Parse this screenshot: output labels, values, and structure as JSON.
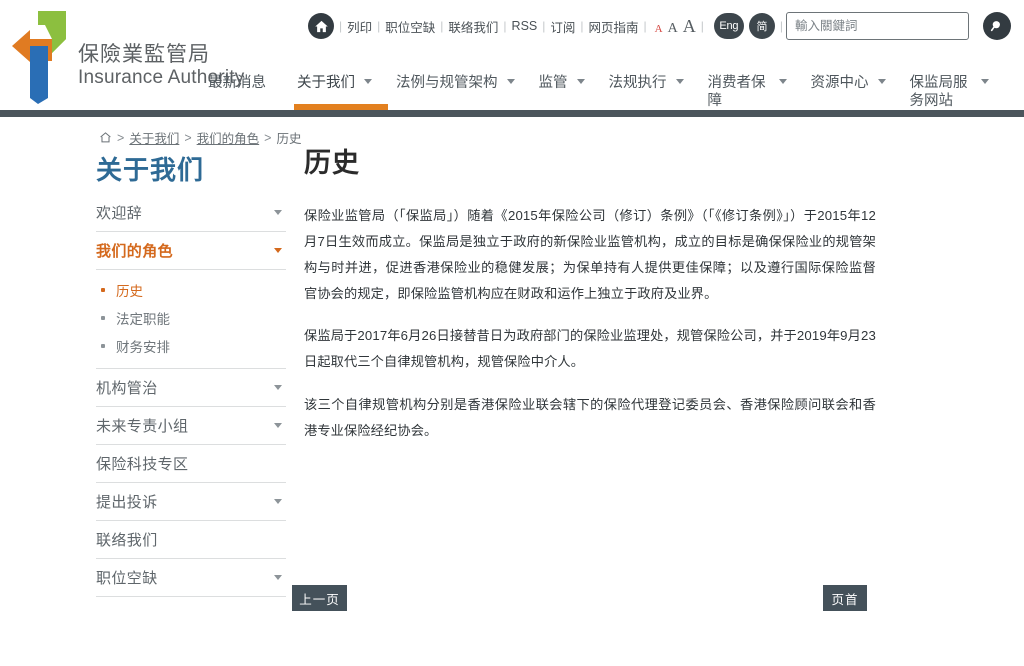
{
  "brand": {
    "logo_icon": "insurance-authority-logo",
    "name_cn": "保險業監管局",
    "name_en": "Insurance Authority",
    "colors": {
      "orange": "#e07b22",
      "green": "#8cbf3f",
      "blue": "#2a6eb5",
      "slate": "#4b555c"
    }
  },
  "utility": {
    "home_icon": "home-icon",
    "links": [
      {
        "label": "列印",
        "name": "print"
      },
      {
        "label": "职位空缺",
        "name": "job-vacancies"
      },
      {
        "label": "联络我们",
        "name": "contact-us"
      },
      {
        "label": "RSS",
        "name": "rss"
      },
      {
        "label": "订阅",
        "name": "subscribe"
      },
      {
        "label": "网页指南",
        "name": "sitemap"
      }
    ],
    "font_sizes": [
      {
        "label": "A",
        "size": "small",
        "active": true
      },
      {
        "label": "A",
        "size": "medium",
        "active": false
      },
      {
        "label": "A",
        "size": "large",
        "active": false
      }
    ],
    "languages": [
      {
        "label": "Eng",
        "name": "english"
      },
      {
        "label": "简",
        "name": "simplified-chinese"
      }
    ],
    "separator": "|"
  },
  "search": {
    "placeholder": "輸入關鍵詞",
    "value": "",
    "button_icon": "search-icon"
  },
  "mainnav": {
    "items": [
      {
        "label": "最新消息",
        "caret": false,
        "active": false,
        "two_line": false
      },
      {
        "label": "关于我们",
        "caret": true,
        "active": true,
        "two_line": false
      },
      {
        "label": "法例与规管架构",
        "caret": true,
        "active": false,
        "two_line": false
      },
      {
        "label": "监管",
        "caret": true,
        "active": false,
        "two_line": false
      },
      {
        "label": "法规执行",
        "caret": true,
        "active": false,
        "two_line": false
      },
      {
        "label": "消费者保障",
        "caret": true,
        "active": false,
        "two_line": true
      },
      {
        "label": "资源中心",
        "caret": true,
        "active": false,
        "two_line": false
      },
      {
        "label": "保监局服务网站",
        "caret": true,
        "active": false,
        "two_line": true
      }
    ],
    "active_indicator_color": "#e3801f"
  },
  "breadcrumb": {
    "home_icon": "home-icon",
    "separator": ">",
    "items": [
      {
        "label": "关于我们",
        "link": true
      },
      {
        "label": "我们的角色",
        "link": true
      },
      {
        "label": "历史",
        "link": false
      }
    ]
  },
  "sidebar": {
    "title": "关于我们",
    "items": [
      {
        "label": "欢迎辞",
        "arrow": true,
        "current": false
      },
      {
        "label": "我们的角色",
        "arrow": true,
        "current": true
      },
      {
        "label": "机构管治",
        "arrow": true,
        "current": false
      },
      {
        "label": "未来专责小组",
        "arrow": true,
        "current": false
      },
      {
        "label": "保险科技专区",
        "arrow": false,
        "current": false
      },
      {
        "label": "提出投诉",
        "arrow": true,
        "current": false
      },
      {
        "label": "联络我们",
        "arrow": false,
        "current": false
      },
      {
        "label": "职位空缺",
        "arrow": true,
        "current": false
      }
    ],
    "subitems": [
      {
        "label": "历史",
        "active": true
      },
      {
        "label": "法定职能",
        "active": false
      },
      {
        "label": "财务安排",
        "active": false
      }
    ],
    "title_color": "#2e6a95",
    "active_color": "#d4691d"
  },
  "content": {
    "title": "历史",
    "paragraphs": [
      "保险业监管局（「保监局」）随着《2015年保险公司（修订）条例》（「《修订条例》」）于2015年12月7日生效而成立。保监局是独立于政府的新保险业监管机构，成立的目标是确保保险业的规管架构与时并进，促进香港保险业的稳健发展；为保单持有人提供更佳保障；以及遵行国际保险监督官协会的规定，即保险监管机构应在财政和运作上独立于政府及业界。",
      "保监局于2017年6月26日接替昔日为政府部门的保险业监理处，规管保险公司，并于2019年9月23日起取代三个自律规管机构，规管保险中介人。",
      "该三个自律规管机构分别是香港保险业联会辖下的保险代理登记委员会、香港保险顾问联会和香港专业保险经纪协会。"
    ]
  },
  "footer": {
    "prev_label": "上一页",
    "top_label": "页首"
  }
}
